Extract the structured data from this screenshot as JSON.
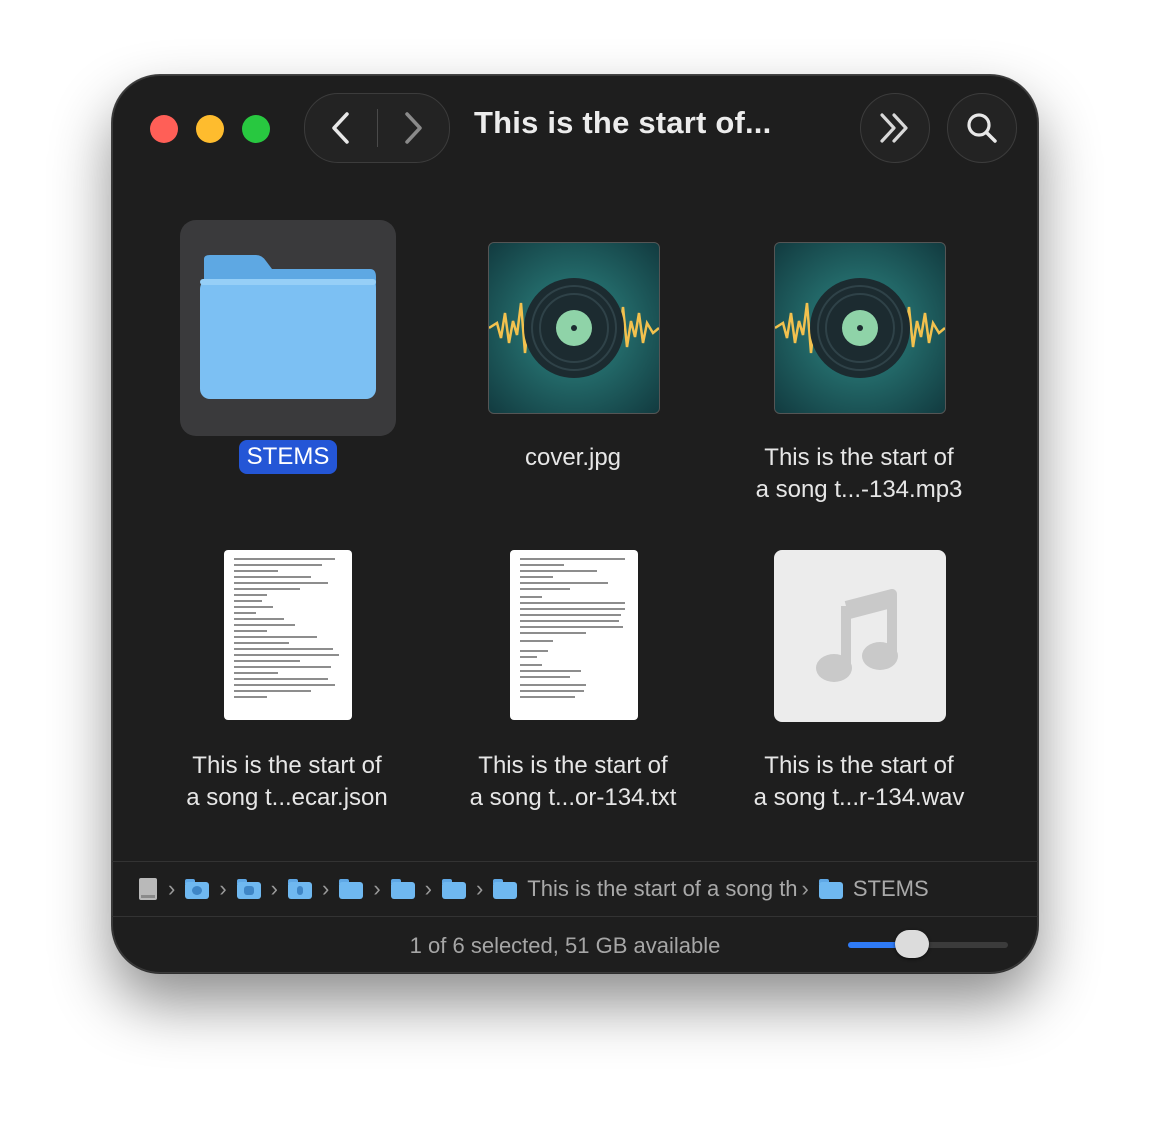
{
  "window": {
    "title": "This is the start of..."
  },
  "toolbar": {
    "back_icon": "chevron-left-icon",
    "forward_icon": "chevron-right-icon",
    "more_icon": "double-chevron-right-icon",
    "search_icon": "magnifier-icon"
  },
  "items": [
    {
      "name": "STEMS",
      "type": "folder",
      "selected": true
    },
    {
      "name": "cover.jpg",
      "type": "image"
    },
    {
      "name_line1": "This is the start of",
      "name_line2": "a song t...-134.mp3",
      "type": "audio-art"
    },
    {
      "name_line1": "This is the start of",
      "name_line2": "a song t...ecar.json",
      "type": "json-doc"
    },
    {
      "name_line1": "This is the start of",
      "name_line2": "a song t...or-134.txt",
      "type": "text-doc"
    },
    {
      "name_line1": "This is the start of",
      "name_line2": "a song t...r-134.wav",
      "type": "wav-generic"
    }
  ],
  "pathbar": {
    "current_parent": "This is the start of a song th",
    "current": "STEMS"
  },
  "status": {
    "text": "1 of 6 selected, 51 GB available",
    "icon_size_fraction": 0.4
  },
  "colors": {
    "selection": "#2456d6",
    "folder": "#6fb8f0",
    "slider_accent": "#2f7bf6"
  }
}
